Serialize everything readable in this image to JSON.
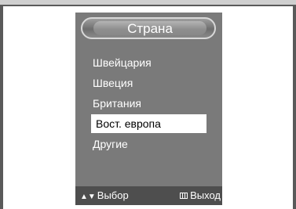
{
  "menu": {
    "title": "Страна",
    "items": [
      {
        "label": "Швейцария",
        "selected": false
      },
      {
        "label": "Швеция",
        "selected": false
      },
      {
        "label": "Британия",
        "selected": false
      },
      {
        "label": "Вост. европа",
        "selected": true
      },
      {
        "label": "Другие",
        "selected": false
      }
    ]
  },
  "footer": {
    "select_glyph": "▲▼",
    "select_label": "Выбор",
    "exit_icon": "menu-icon",
    "exit_label": "Выход"
  },
  "colors": {
    "panel": "#7a7a7a",
    "footer": "#4e4e4e",
    "highlight": "#ffffff",
    "text": "#ffffff"
  }
}
